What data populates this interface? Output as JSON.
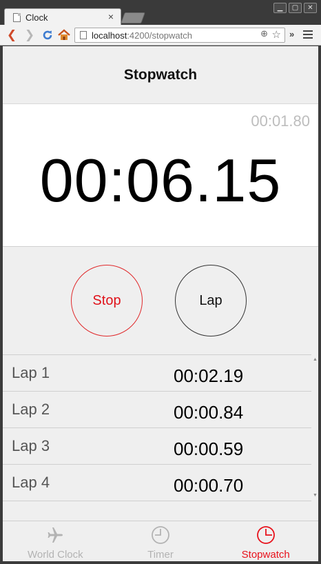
{
  "browser": {
    "tab_title": "Clock",
    "tab_close": "×",
    "url_host": "localhost",
    "url_path": ":4200/stopwatch",
    "extensions_label": "»",
    "window_buttons": [
      "▁",
      "▢",
      "✕"
    ]
  },
  "header": {
    "title": "Stopwatch"
  },
  "stopwatch": {
    "current_lap_time": "00:01.80",
    "elapsed_time": "00:06.15"
  },
  "controls": {
    "stop_label": "Stop",
    "lap_label": "Lap",
    "stop_color": "#e0121a"
  },
  "laps": [
    {
      "name": "Lap 1",
      "time": "00:02.19"
    },
    {
      "name": "Lap 2",
      "time": "00:00.84"
    },
    {
      "name": "Lap 3",
      "time": "00:00.59"
    },
    {
      "name": "Lap 4",
      "time": "00:00.70"
    }
  ],
  "tabbar": {
    "items": [
      {
        "label": "World Clock",
        "icon": "airplane-icon",
        "active": false
      },
      {
        "label": "Timer",
        "icon": "timer-icon",
        "active": false
      },
      {
        "label": "Stopwatch",
        "icon": "stopwatch-icon",
        "active": true
      }
    ],
    "active_color": "#e8111b",
    "inactive_color": "#b3b3b3"
  }
}
